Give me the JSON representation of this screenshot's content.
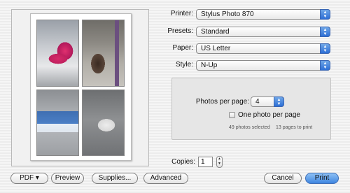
{
  "preview": {
    "thumbnails": [
      "pink-pig-sculpture",
      "bear-sculpture-street",
      "blue-chair-sculpture",
      "white-sculpture-grey-floor"
    ]
  },
  "printer": {
    "label": "Printer:",
    "value": "Stylus Photo 870"
  },
  "presets": {
    "label": "Presets:",
    "value": "Standard"
  },
  "paper": {
    "label": "Paper:",
    "value": "US Letter"
  },
  "style": {
    "label": "Style:",
    "value": "N-Up"
  },
  "nup": {
    "photos_per_page_label": "Photos per page:",
    "photos_per_page_value": "4",
    "one_photo_label": "One photo per page",
    "one_photo_checked": false,
    "photos_selected": "49 photos selected",
    "pages_to_print": "13 pages to print"
  },
  "copies": {
    "label": "Copies:",
    "value": "1"
  },
  "buttons": {
    "pdf": "PDF ▾",
    "preview": "Preview",
    "supplies": "Supplies...",
    "advanced": "Advanced",
    "cancel": "Cancel",
    "print": "Print"
  },
  "colors": {
    "accent": "#3f86e0",
    "panel": "#e6e6e6"
  }
}
